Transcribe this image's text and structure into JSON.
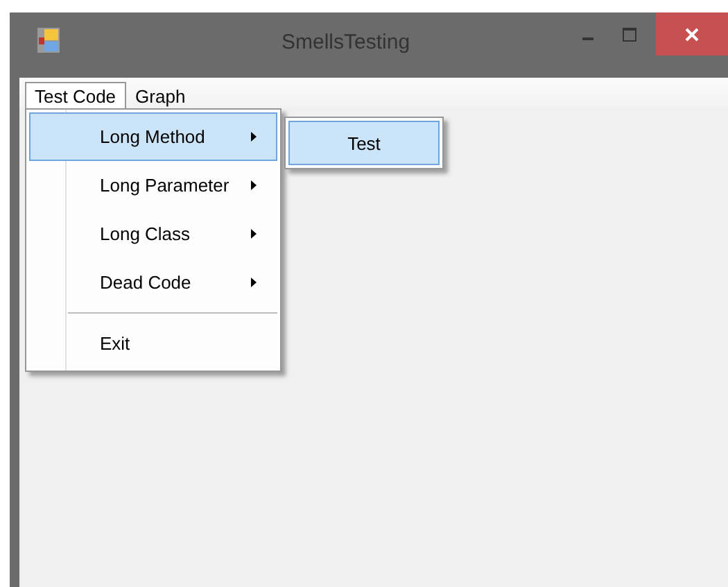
{
  "window": {
    "title": "SmellsTesting"
  },
  "menu_bar": [
    {
      "label": "Test Code",
      "selected": true
    },
    {
      "label": "Graph",
      "selected": false
    }
  ],
  "dropdown": [
    {
      "kind": "submenu",
      "label": "Long Method",
      "selected": true
    },
    {
      "kind": "submenu",
      "label": "Long Parameter",
      "selected": false
    },
    {
      "kind": "submenu",
      "label": "Long Class",
      "selected": false
    },
    {
      "kind": "submenu",
      "label": "Dead Code",
      "selected": false
    },
    {
      "kind": "separator"
    },
    {
      "kind": "item",
      "label": "Exit",
      "selected": false
    }
  ],
  "submenu": [
    {
      "label": "Test",
      "selected": true
    }
  ]
}
